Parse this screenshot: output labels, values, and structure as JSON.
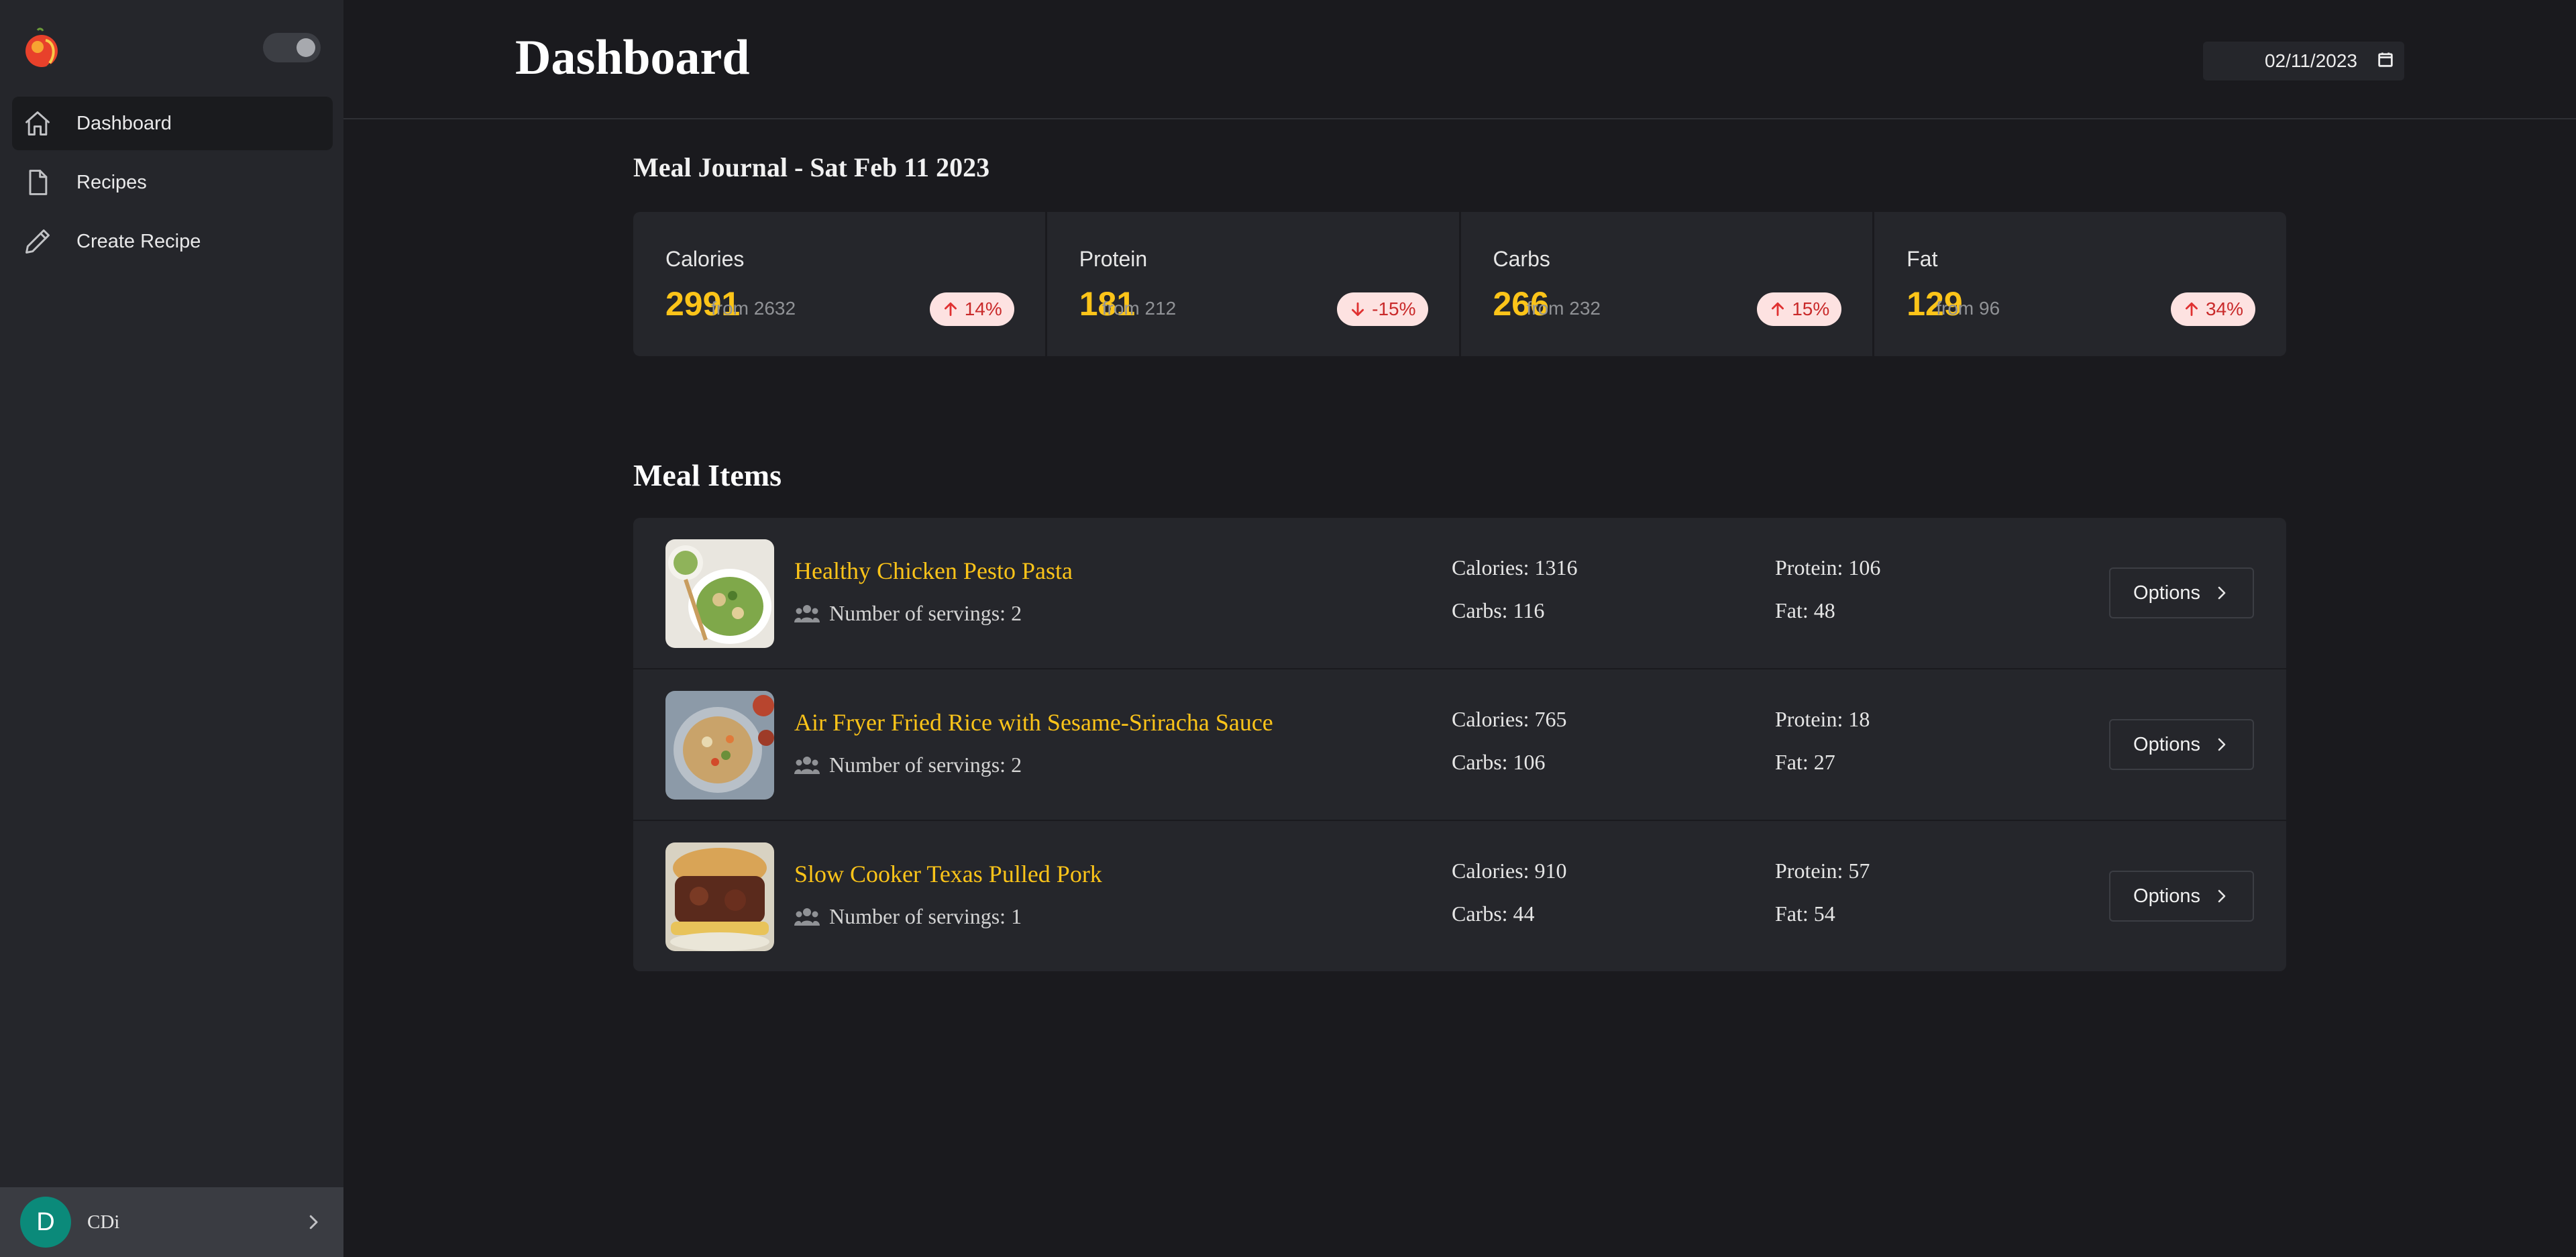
{
  "sidebar": {
    "items": [
      {
        "label": "Dashboard",
        "icon": "home-icon",
        "active": true
      },
      {
        "label": "Recipes",
        "icon": "file-icon"
      },
      {
        "label": "Create Recipe",
        "icon": "pencil-icon"
      }
    ],
    "user": {
      "initial": "D",
      "name": "CDi"
    }
  },
  "header": {
    "title": "Dashboard",
    "date_value": "02/11/2023"
  },
  "journal": {
    "title": "Meal Journal - Sat Feb 11 2023",
    "stats": [
      {
        "name": "Calories",
        "value": "2991",
        "from": "from 2632",
        "change": "14%",
        "direction": "up"
      },
      {
        "name": "Protein",
        "value": "181",
        "from": "from 212",
        "change": "-15%",
        "direction": "down"
      },
      {
        "name": "Carbs",
        "value": "266",
        "from": "from 232",
        "change": "15%",
        "direction": "up"
      },
      {
        "name": "Fat",
        "value": "129",
        "from": "from 96",
        "change": "34%",
        "direction": "up"
      }
    ]
  },
  "meal_items": {
    "title": "Meal Items",
    "labels": {
      "servings": "Number of servings:",
      "calories": "Calories:",
      "carbs": "Carbs:",
      "protein": "Protein:",
      "fat": "Fat:",
      "options": "Options"
    },
    "items": [
      {
        "name": "Healthy Chicken Pesto Pasta",
        "servings": "2",
        "calories": "1316",
        "carbs": "116",
        "protein": "106",
        "fat": "48"
      },
      {
        "name": "Air Fryer Fried Rice with Sesame-Sriracha Sauce",
        "servings": "2",
        "calories": "765",
        "carbs": "106",
        "protein": "18",
        "fat": "27"
      },
      {
        "name": "Slow Cooker Texas Pulled Pork",
        "servings": "1",
        "calories": "910",
        "carbs": "44",
        "protein": "57",
        "fat": "54"
      }
    ]
  },
  "colors": {
    "accent": "#fcc419",
    "badge_bg": "#fde2e1",
    "badge_text": "#c92a2a",
    "avatar": "#0b8a7a"
  }
}
